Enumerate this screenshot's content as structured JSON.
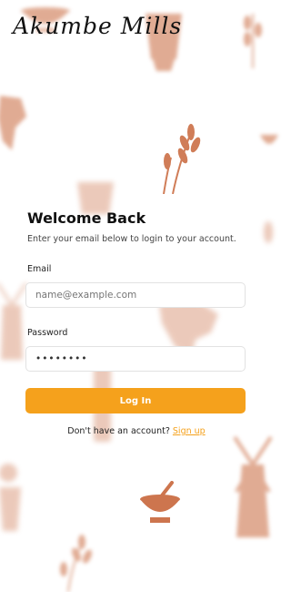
{
  "brand": {
    "name": "Akumbe Mills"
  },
  "login": {
    "title": "Welcome Back",
    "subtitle": "Enter your email below to login to your account.",
    "email_label": "Email",
    "email_placeholder": "name@example.com",
    "password_label": "Password",
    "password_value": "••••••••",
    "submit_label": "Log In",
    "signup_prompt": "Don't have an account?",
    "signup_link": "Sign up"
  },
  "colors": {
    "accent": "#f5a11c",
    "motif": "#c8673b"
  }
}
